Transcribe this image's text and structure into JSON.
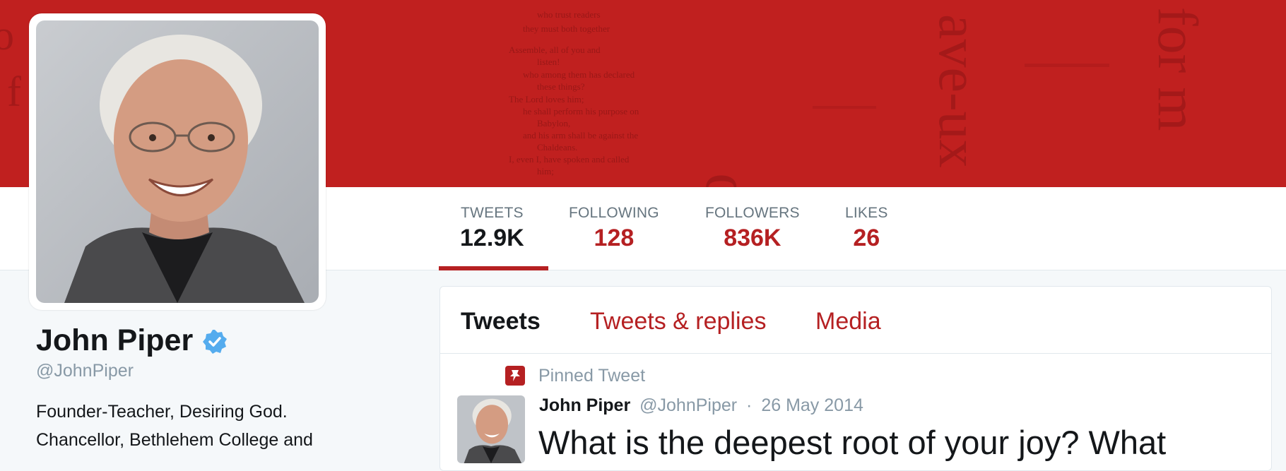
{
  "banner": {
    "accent": "#c0201f"
  },
  "stats": [
    {
      "label": "TWEETS",
      "value": "12.9K",
      "active": true
    },
    {
      "label": "FOLLOWING",
      "value": "128"
    },
    {
      "label": "FOLLOWERS",
      "value": "836K"
    },
    {
      "label": "LIKES",
      "value": "26"
    }
  ],
  "profile": {
    "name": "John Piper",
    "handle": "@JohnPiper",
    "verified_icon": "verified-badge-icon",
    "bio_lines": [
      "Founder-Teacher, Desiring God.",
      "Chancellor, Bethlehem College and"
    ]
  },
  "timeline": {
    "tabs": [
      {
        "label": "Tweets",
        "active": true
      },
      {
        "label": "Tweets & replies"
      },
      {
        "label": "Media"
      }
    ],
    "pinned_label": "Pinned Tweet",
    "tweet": {
      "author": "John Piper",
      "handle": "@JohnPiper",
      "separator": "·",
      "date": "26 May 2014",
      "text": "What is the deepest root of your joy? What"
    }
  },
  "colors": {
    "brand_red": "#b52022",
    "text_dark": "#14171a",
    "text_muted": "#8899a6",
    "verified_blue": "#55acee"
  }
}
